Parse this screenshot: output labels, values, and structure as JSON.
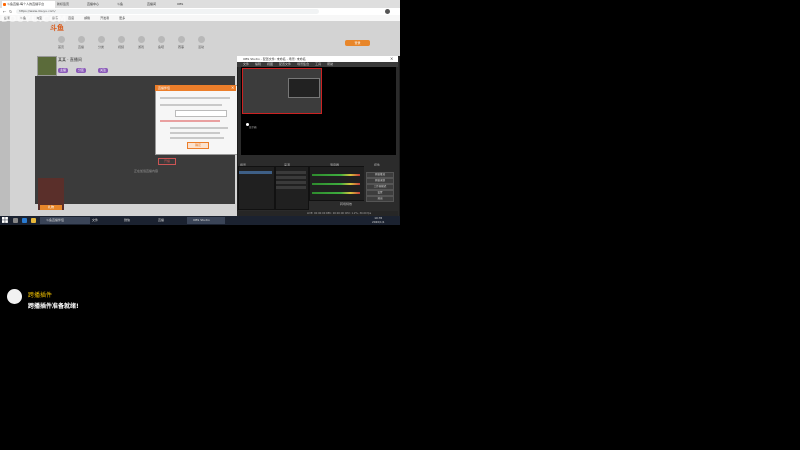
{
  "browser": {
    "tabs": [
      "斗鱼直播-每个人的直播平台",
      "新标签页",
      "直播中心",
      "斗鱼",
      "直播间",
      "OBS"
    ],
    "url": "https://www.douyu.com/",
    "bookmarks": [
      "应用",
      "斗鱼",
      "淘宝",
      "京东",
      "百度",
      "邮箱",
      "开发者",
      "更多"
    ]
  },
  "watermark": "DOUYU.COM",
  "site": {
    "logo": "斗鱼",
    "nav_labels": [
      "首页",
      "直播",
      "分类",
      "视频",
      "游戏",
      "鱼吧",
      "赛事",
      "活动"
    ],
    "login_label": "登录",
    "room_title": "某某 · 直播间",
    "room_tags": [
      "主播",
      "分区",
      "关注"
    ],
    "player_button": "开播",
    "player_hint": "正在加载直播内容",
    "gift_label": "礼物"
  },
  "dialog": {
    "title": "直播伴侣",
    "button": "确定"
  },
  "obs": {
    "title": "OBS Studio - 配置文件: 未命名 - 场景: 未命名",
    "menu": [
      "文件",
      "编辑",
      "视图",
      "配置文件",
      "场景集合",
      "工具",
      "帮助"
    ],
    "cursor_label": "显示器",
    "panels": [
      "场景",
      "来源",
      "混音器",
      "转场特效",
      "控件"
    ],
    "controls": [
      "开始推流",
      "开始录制",
      "工作室模式",
      "设置",
      "退出"
    ],
    "status": "LIVE: 00:00:00  REC: 00:00:00  CPU: 1.2%, 30.00 fps"
  },
  "taskbar": {
    "apps": [
      "斗鱼直播伴侣",
      "文件",
      "微信",
      "OBS Studio",
      "直播"
    ],
    "time": "10:35",
    "date": "2020/1/1"
  },
  "chat": {
    "username": "跨播插件",
    "message": "跨播插件准备就绪!"
  },
  "colors": {
    "accent": "#ec7e2a",
    "chat_name": "#f5c400"
  }
}
